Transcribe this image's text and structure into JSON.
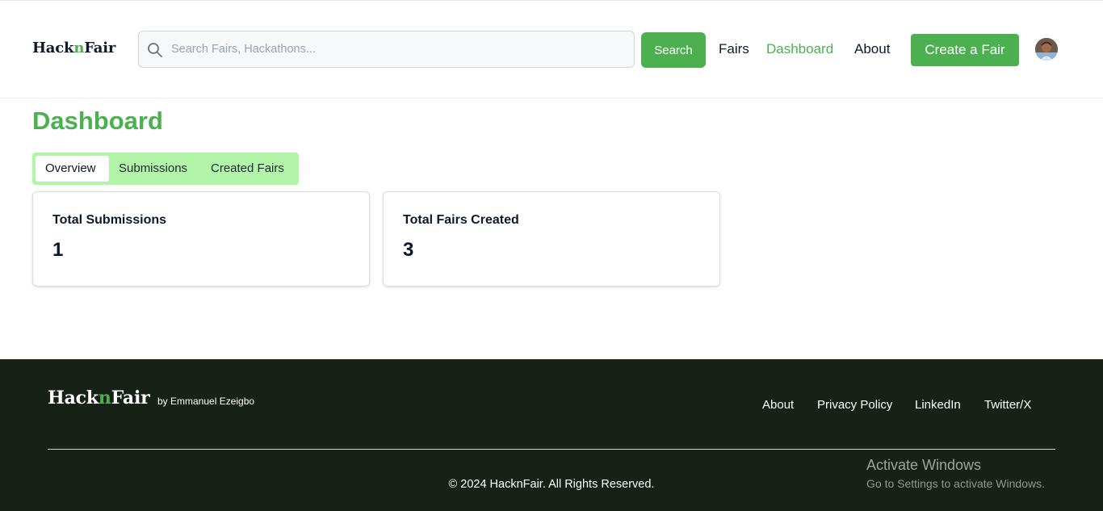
{
  "header": {
    "logo": {
      "part1": "Hack",
      "part2": "n",
      "part3": "Fair"
    },
    "search": {
      "placeholder": "Search Fairs, Hackathons...",
      "value": "",
      "button_label": "Search"
    },
    "nav": {
      "fairs": "Fairs",
      "dashboard": "Dashboard",
      "about": "About"
    },
    "create_button": "Create a Fair",
    "accent_color": "#4caf50"
  },
  "main": {
    "title": "Dashboard",
    "tabs": [
      {
        "label": "Overview",
        "active": true
      },
      {
        "label": "Submissions",
        "active": false
      },
      {
        "label": "Created Fairs",
        "active": false
      }
    ],
    "cards": [
      {
        "label": "Total Submissions",
        "value": "1"
      },
      {
        "label": "Total Fairs Created",
        "value": "3"
      }
    ]
  },
  "footer": {
    "logo": {
      "part1": "Hack",
      "part2": "n",
      "part3": "Fair"
    },
    "byline": "by Emmanuel Ezeigbo",
    "links": {
      "about": "About",
      "privacy": "Privacy Policy",
      "linkedin": "LinkedIn",
      "twitter": "Twitter/X"
    },
    "copyright": "© 2024 HacknFair. All Rights Reserved.",
    "background_color": "#172118"
  },
  "watermark": {
    "title": "Activate Windows",
    "subtitle": "Go to Settings to activate Windows."
  }
}
